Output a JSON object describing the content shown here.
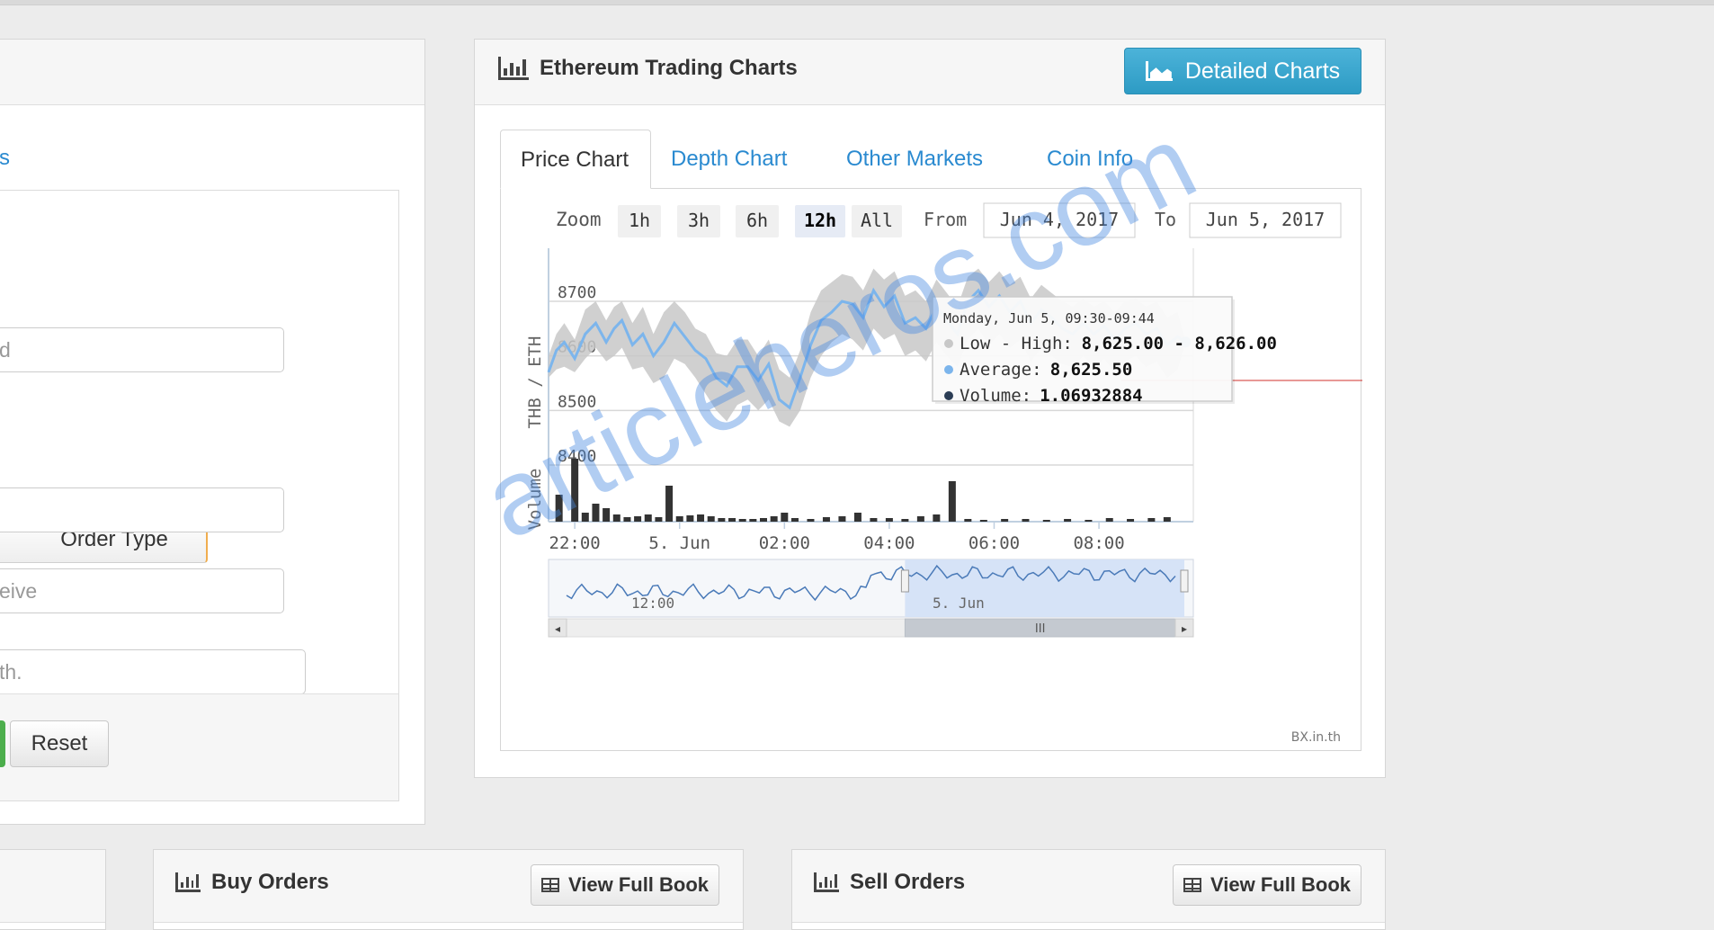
{
  "left_panel": {
    "tab_link": "s",
    "fields": [
      {
        "placeholder": "d"
      },
      {
        "placeholder": ""
      },
      {
        "placeholder": "eive"
      },
      {
        "placeholder": "th."
      }
    ],
    "order_type_label": "Order Type",
    "reset_label": "Reset"
  },
  "chart_panel": {
    "title": "Ethereum Trading Charts",
    "detailed_button": "Detailed Charts",
    "tabs": [
      "Price Chart",
      "Depth Chart",
      "Other Markets",
      "Coin Info"
    ],
    "active_tab": "Price Chart",
    "zoom_label": "Zoom",
    "zoom_options": [
      "1h",
      "3h",
      "6h",
      "12h",
      "All"
    ],
    "zoom_selected": "12h",
    "from_label": "From",
    "from_value": "Jun 4, 2017",
    "to_label": "To",
    "to_value": "Jun 5, 2017",
    "credit": "BX.in.th"
  },
  "chart_data": {
    "type": "area",
    "ylabel": "THB / ETH",
    "volume_label": "Volume",
    "y_ticks": [
      8700,
      8600,
      8500,
      8400
    ],
    "ylim": [
      8400,
      8700
    ],
    "x_ticks": [
      "22:00",
      "5. Jun",
      "02:00",
      "04:00",
      "06:00",
      "08:00"
    ],
    "x_tick_hours": [
      -2,
      0,
      2,
      4,
      6,
      8
    ],
    "x_range_hours": [
      -2.5,
      9.8
    ],
    "series": [
      {
        "name": "Average",
        "x_hours": [
          -2.5,
          -2.35,
          -2.2,
          -2.0,
          -1.8,
          -1.6,
          -1.4,
          -1.25,
          -1.1,
          -0.9,
          -0.7,
          -0.5,
          -0.3,
          -0.1,
          0.1,
          0.3,
          0.5,
          0.7,
          0.9,
          1.1,
          1.3,
          1.5,
          1.7,
          1.9,
          2.1,
          2.3,
          2.5,
          2.7,
          2.9,
          3.1,
          3.3,
          3.5,
          3.7,
          3.9,
          4.1,
          4.3,
          4.5,
          4.7,
          4.9,
          5.1,
          5.3,
          5.5,
          5.7,
          5.9,
          6.1,
          6.3,
          6.5,
          6.7,
          6.9,
          7.1,
          7.3,
          7.5,
          7.7,
          7.9,
          8.1,
          8.3,
          8.5,
          8.7,
          8.9,
          9.1,
          9.3,
          9.5,
          9.65
        ],
        "values": [
          8570,
          8610,
          8625,
          8595,
          8640,
          8660,
          8625,
          8650,
          8665,
          8620,
          8640,
          8600,
          8625,
          8660,
          8635,
          8610,
          8595,
          8560,
          8545,
          8580,
          8580,
          8555,
          8585,
          8520,
          8505,
          8560,
          8620,
          8665,
          8680,
          8700,
          8695,
          8670,
          8720,
          8690,
          8710,
          8660,
          8670,
          8650,
          8690,
          8665,
          8640,
          8700,
          8720,
          8690,
          8710,
          8680,
          8700,
          8660,
          8685,
          8670,
          8650,
          8640,
          8660,
          8640,
          8655,
          8630,
          8650,
          8660,
          8640,
          8650,
          8620,
          8635,
          8625.5
        ]
      }
    ],
    "range_low": [
      8560,
      8575,
      8580,
      8570,
      8595,
      8615,
      8590,
      8600,
      8615,
      8575,
      8580,
      8550,
      8560,
      8595,
      8585,
      8560,
      8530,
      8500,
      8480,
      8510,
      8520,
      8500,
      8520,
      8480,
      8470,
      8500,
      8560,
      8600,
      8625,
      8640,
      8630,
      8610,
      8650,
      8630,
      8640,
      8600,
      8610,
      8590,
      8625,
      8600,
      8580,
      8630,
      8650,
      8620,
      8640,
      8615,
      8630,
      8590,
      8615,
      8600,
      8585,
      8580,
      8600,
      8580,
      8595,
      8570,
      8590,
      8600,
      8580,
      8590,
      8560,
      8575,
      8625
    ],
    "range_high": [
      8600,
      8640,
      8660,
      8630,
      8685,
      8700,
      8665,
      8690,
      8700,
      8660,
      8690,
      8640,
      8680,
      8700,
      8680,
      8650,
      8640,
      8605,
      8600,
      8630,
      8630,
      8600,
      8630,
      8575,
      8560,
      8610,
      8680,
      8720,
      8735,
      8750,
      8745,
      8720,
      8760,
      8740,
      8755,
      8710,
      8720,
      8700,
      8740,
      8715,
      8690,
      8745,
      8760,
      8735,
      8755,
      8730,
      8745,
      8705,
      8730,
      8715,
      8700,
      8690,
      8705,
      8690,
      8700,
      8680,
      8700,
      8705,
      8690,
      8700,
      8670,
      8680,
      8626
    ],
    "volume_x_hours": [
      -2.3,
      -2.0,
      -1.8,
      -1.6,
      -1.4,
      -1.2,
      -1.0,
      -0.8,
      -0.6,
      -0.4,
      -0.2,
      0.0,
      0.2,
      0.4,
      0.6,
      0.8,
      1.0,
      1.2,
      1.4,
      1.6,
      1.8,
      2.0,
      2.2,
      2.5,
      2.8,
      3.1,
      3.4,
      3.7,
      4.0,
      4.3,
      4.6,
      4.9,
      5.2,
      5.5,
      5.8,
      6.2,
      6.6,
      7.0,
      7.4,
      7.8,
      8.2,
      8.6,
      9.0,
      9.3
    ],
    "volume_values": [
      30,
      70,
      10,
      20,
      15,
      8,
      5,
      6,
      8,
      5,
      40,
      6,
      7,
      8,
      6,
      4,
      4,
      3,
      3,
      4,
      6,
      10,
      4,
      3,
      5,
      6,
      10,
      4,
      4,
      3,
      6,
      8,
      45,
      3,
      2,
      3,
      3,
      2,
      3,
      2,
      4,
      3,
      4,
      5
    ],
    "navigator_labels": [
      "12:00",
      "5. Jun"
    ],
    "tooltip": {
      "header": "Monday, Jun 5, 09:30-09:44",
      "rows": [
        {
          "label": "Low - High:",
          "value": "8,625.00 - 8,626.00",
          "color": "#c8c8c8"
        },
        {
          "label": "Average:",
          "value": "8,625.50",
          "color": "#7cb5ec"
        },
        {
          "label": "Volume:",
          "value": "1.06932884",
          "color": "#2b3d55"
        }
      ]
    },
    "colors": {
      "line": "#7cb5ec",
      "range": "#c8c8c8",
      "volume": "#333333",
      "selection": "#d4e2f7"
    }
  },
  "buy_orders": {
    "title": "Buy Orders",
    "button": "View Full Book"
  },
  "sell_orders": {
    "title": "Sell Orders",
    "button": "View Full Book"
  },
  "watermark": "articleheros.com"
}
